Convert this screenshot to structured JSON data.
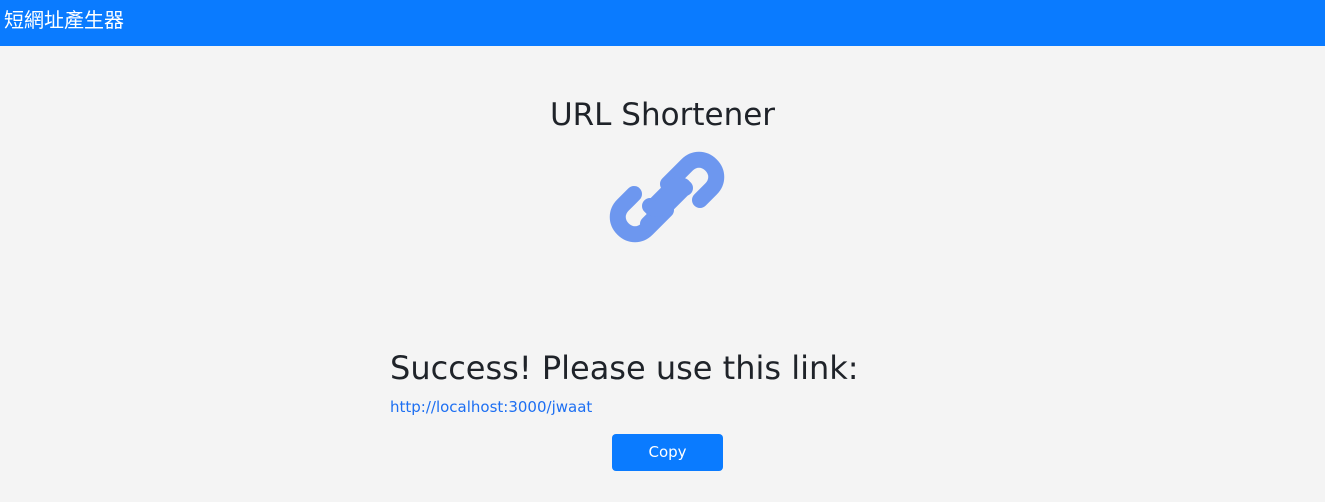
{
  "navbar": {
    "brand": "短網址產生器",
    "color": "#0a7bff"
  },
  "main": {
    "title": "URL Shortener",
    "logo_icon": "link-icon",
    "success_message": "Success! Please use this link:",
    "short_url": "http://localhost:3000/jwaat",
    "copy_button_label": "Copy",
    "accent_color": "#0a7bff",
    "logo_color": "#6d97ef"
  }
}
